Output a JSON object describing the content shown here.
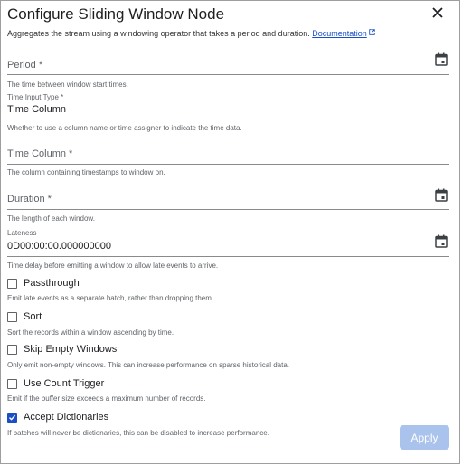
{
  "dialog": {
    "title": "Configure Sliding Window Node",
    "subtitle": "Aggregates the stream using a windowing operator that takes a period and duration.",
    "doc_link": "Documentation"
  },
  "fields": {
    "period": {
      "label": "Period *",
      "helper": "The time between window start times."
    },
    "time_input_type": {
      "label": "Time Input Type *",
      "value": "Time Column",
      "helper": "Whether to use a column name or time assigner to indicate the time data."
    },
    "time_column": {
      "label": "Time Column *",
      "helper": "The column containing timestamps to window on."
    },
    "duration": {
      "label": "Duration *",
      "helper": "The length of each window."
    },
    "lateness": {
      "label": "Lateness",
      "value": "0D00:00:00.000000000",
      "helper": "Time delay before emitting a window to allow late events to arrive."
    }
  },
  "checkboxes": [
    {
      "label": "Passthrough",
      "checked": false,
      "helper": "Emit late events as a separate batch, rather than dropping them."
    },
    {
      "label": "Sort",
      "checked": false,
      "helper": "Sort the records within a window ascending by time."
    },
    {
      "label": "Skip Empty Windows",
      "checked": false,
      "helper": "Only emit non-empty windows. This can increase performance on sparse historical data."
    },
    {
      "label": "Use Count Trigger",
      "checked": false,
      "helper": "Emit if the buffer size exceeds a maximum number of records."
    },
    {
      "label": "Accept Dictionaries",
      "checked": true,
      "helper": "If batches will never be dictionaries, this can be disabled to increase performance."
    }
  ],
  "actions": {
    "apply_label": "Apply"
  },
  "colors": {
    "accent": "#1a4fc4",
    "apply_disabled": "#a9c3ec"
  }
}
